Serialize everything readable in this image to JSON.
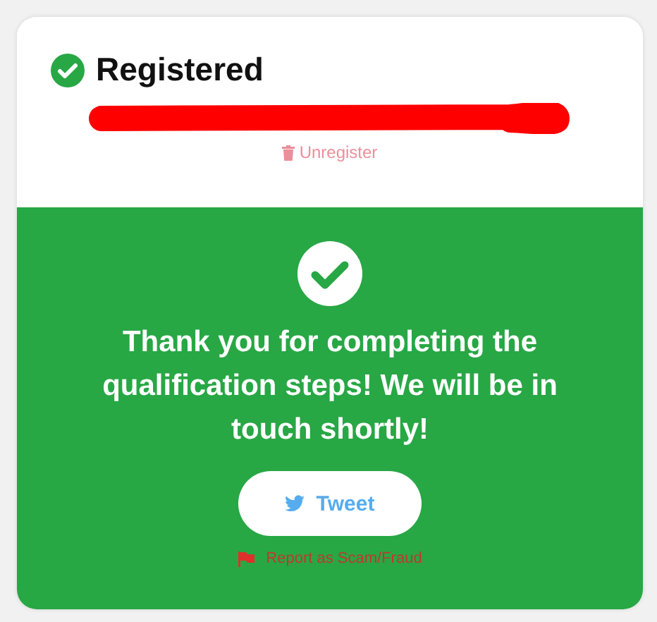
{
  "header": {
    "title": "Registered",
    "unregister_link": "Unregister"
  },
  "confirmation": {
    "message": "Thank you for completing the qualification steps! We will be in touch shortly!",
    "tweet_button": "Tweet",
    "report_link": "Report as Scam/Fraud"
  }
}
